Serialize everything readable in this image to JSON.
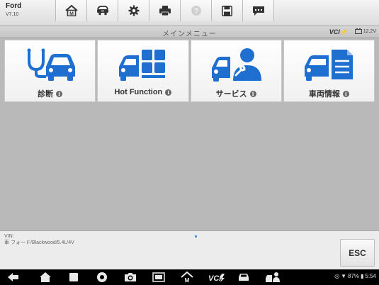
{
  "vehicle": {
    "make": "Ford",
    "version": "V7.10"
  },
  "toolbar": {
    "tools": [
      {
        "name": "home-icon"
      },
      {
        "name": "vehicle-swap-icon"
      },
      {
        "name": "settings-icon"
      },
      {
        "name": "printer-icon"
      },
      {
        "name": "help-icon"
      },
      {
        "name": "save-icon"
      },
      {
        "name": "chat-icon"
      }
    ]
  },
  "titlebar": {
    "title": "メインメニュー",
    "vci_label": "VCI",
    "battery": "12.2V"
  },
  "tiles": [
    {
      "label": "診断",
      "icon": "diagnosis-icon"
    },
    {
      "label": "Hot Function",
      "icon": "hot-function-icon"
    },
    {
      "label": "サービス",
      "icon": "service-icon"
    },
    {
      "label": "車両情報",
      "icon": "vehicle-info-icon"
    }
  ],
  "info": {
    "vin_label": "VIN:",
    "vehicle_desc": "車 フォード/Blackwood/5.4L/4V"
  },
  "esc_label": "ESC",
  "status": {
    "battery_pct": "87%",
    "time": "5:54"
  },
  "colors": {
    "accent_blue": "#1f6fd1",
    "vci_green": "#79b61c"
  }
}
